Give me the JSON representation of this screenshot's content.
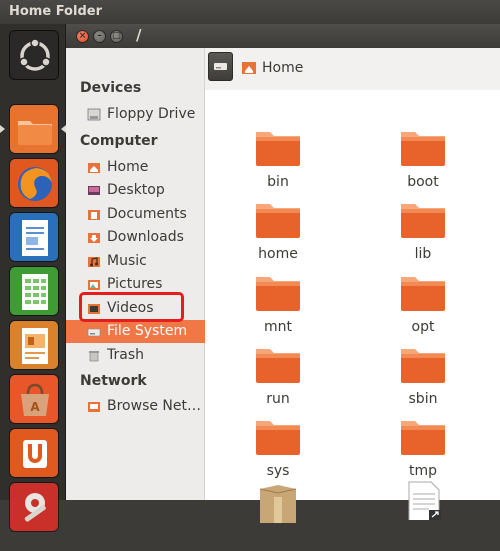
{
  "top_panel": {
    "title": "Home Folder"
  },
  "window": {
    "path_title": "/"
  },
  "launcher": {
    "items": [
      {
        "name": "dash-home",
        "icon": "ubuntu-logo-icon"
      },
      {
        "name": "files",
        "icon": "folder-icon"
      },
      {
        "name": "firefox",
        "icon": "firefox-icon"
      },
      {
        "name": "libreoffice-writer",
        "icon": "writer-icon"
      },
      {
        "name": "libreoffice-calc",
        "icon": "calc-icon"
      },
      {
        "name": "libreoffice-impress",
        "icon": "impress-icon"
      },
      {
        "name": "software-center",
        "icon": "shopping-bag-icon"
      },
      {
        "name": "ubuntu-one",
        "icon": "ubuntu-one-icon"
      },
      {
        "name": "system-settings",
        "icon": "settings-icon"
      }
    ]
  },
  "sidebar": {
    "devices_header": "Devices",
    "devices": [
      {
        "label": "Floppy Drive",
        "icon": "floppy-icon"
      }
    ],
    "computer_header": "Computer",
    "computer": [
      {
        "label": "Home",
        "icon": "home-icon"
      },
      {
        "label": "Desktop",
        "icon": "desktop-icon"
      },
      {
        "label": "Documents",
        "icon": "documents-icon"
      },
      {
        "label": "Downloads",
        "icon": "downloads-icon"
      },
      {
        "label": "Music",
        "icon": "music-icon"
      },
      {
        "label": "Pictures",
        "icon": "pictures-icon"
      },
      {
        "label": "Videos",
        "icon": "videos-icon"
      },
      {
        "label": "File System",
        "icon": "drive-icon",
        "selected": true
      },
      {
        "label": "Trash",
        "icon": "trash-icon"
      }
    ],
    "network_header": "Network",
    "network": [
      {
        "label": "Browse Net…",
        "icon": "network-icon"
      }
    ]
  },
  "pathbar": {
    "home_label": "Home"
  },
  "files": [
    {
      "label": "bin",
      "icon": "folder-icon"
    },
    {
      "label": "boot",
      "icon": "folder-icon"
    },
    {
      "label": "home",
      "icon": "folder-icon"
    },
    {
      "label": "lib",
      "icon": "folder-icon"
    },
    {
      "label": "mnt",
      "icon": "folder-icon"
    },
    {
      "label": "opt",
      "icon": "folder-icon"
    },
    {
      "label": "run",
      "icon": "folder-icon"
    },
    {
      "label": "sbin",
      "icon": "folder-icon"
    },
    {
      "label": "sys",
      "icon": "folder-icon"
    },
    {
      "label": "tmp",
      "icon": "folder-icon"
    },
    {
      "label": "",
      "icon": "package-icon"
    },
    {
      "label": "",
      "icon": "symlink-document-icon"
    }
  ],
  "colors": {
    "accent": "#f07746",
    "folder_top": "#f6a678",
    "folder_body": "#e8632c",
    "highlight_outline": "#e61d1d"
  }
}
